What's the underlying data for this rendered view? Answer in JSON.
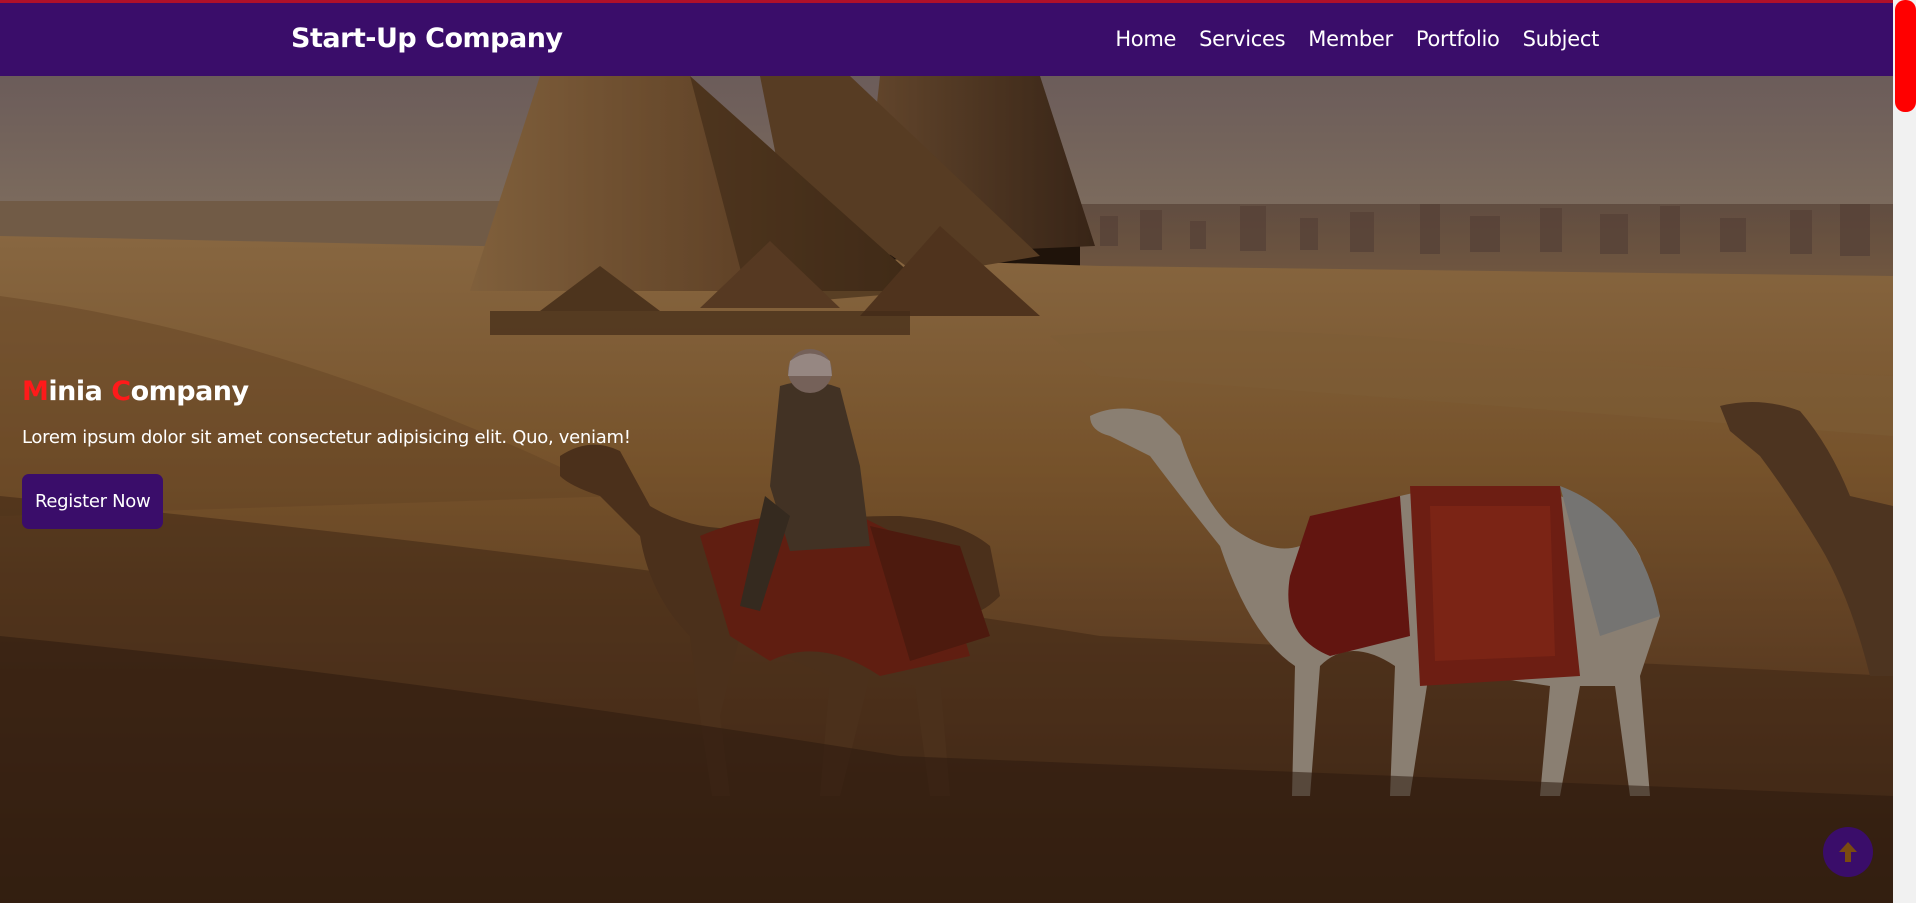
{
  "navbar": {
    "brand": "Start-Up Company",
    "links": [
      "Home",
      "Services",
      "Member",
      "Portfolio",
      "Subject"
    ]
  },
  "hero": {
    "title_first_letter_1": "M",
    "title_rest_1": "inia ",
    "title_first_letter_2": "C",
    "title_rest_2": "ompany",
    "subtitle": "Lorem ipsum dolor sit amet consectetur adipisicing elit. Quo, veniam!",
    "cta_label": "Register Now"
  },
  "colors": {
    "primary": "#3a0d6a",
    "accent": "#ff1a1a",
    "top_border": "#b0102a",
    "scrollbar_thumb": "#ff0000"
  },
  "icons": {
    "scroll_top": "arrow-up-icon"
  }
}
